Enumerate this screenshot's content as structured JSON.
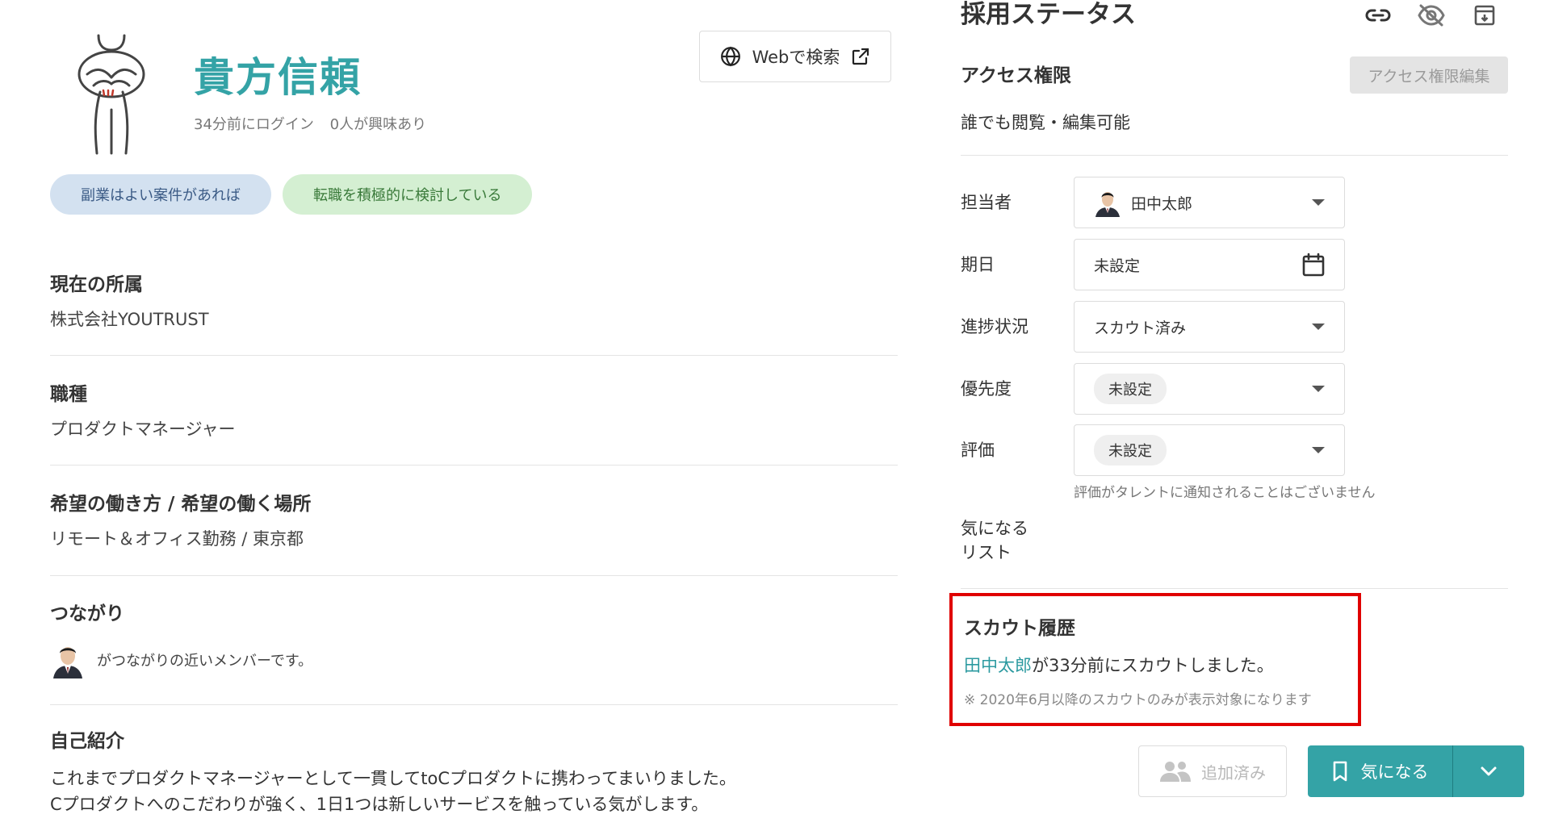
{
  "profile": {
    "name": "貴方信頼",
    "last_login": "34分前にログイン",
    "interest": "0人が興味あり",
    "web_search_label": "Webで検索",
    "tags": [
      "副業はよい案件があれば",
      "転職を積極的に検討している"
    ]
  },
  "sections": {
    "affiliation": {
      "title": "現在の所属",
      "value": "株式会社YOUTRUST"
    },
    "occupation": {
      "title": "職種",
      "value": "プロダクトマネージャー"
    },
    "work_style": {
      "title": "希望の働き方 / 希望の働く場所",
      "value": "リモート＆オフィス勤務 / 東京都"
    },
    "connection": {
      "title": "つながり",
      "text": "がつながりの近いメンバーです。"
    },
    "intro": {
      "title": "自己紹介",
      "lines": [
        "これまでプロダクトマネージャーとして一貫してtoCプロダクトに携わってまいりました。",
        "Cプロダクトへのこだわりが強く、1日1つは新しいサービスを触っている気がします。"
      ]
    }
  },
  "status_panel": {
    "title": "採用ステータス",
    "icons": [
      "link-icon",
      "eye-off-icon",
      "archive-icon"
    ],
    "access": {
      "title": "アクセス権限",
      "edit_label": "アクセス権限編集",
      "value": "誰でも閲覧・編集可能"
    },
    "fields": {
      "assignee": {
        "label": "担当者",
        "value": "田中太郎"
      },
      "due_date": {
        "label": "期日",
        "value": "未設定"
      },
      "progress": {
        "label": "進捗状況",
        "value": "スカウト済み"
      },
      "priority": {
        "label": "優先度",
        "value": "未設定"
      },
      "evaluation": {
        "label": "評価",
        "value": "未設定"
      },
      "watchlist": {
        "label_line1": "気になる",
        "label_line2": "リスト"
      }
    },
    "evaluation_note": "評価がタレントに通知されることはございません"
  },
  "scout_history": {
    "title": "スカウト履歴",
    "user": "田中太郎",
    "message": "が33分前にスカウトしました。",
    "footnote": "※ 2020年6月以降のスカウトのみが表示対象になります"
  },
  "actions": {
    "added_label": "追加済み",
    "interest_label": "気になる"
  },
  "colors": {
    "accent": "#34a3a6",
    "highlight_border": "#e00000"
  }
}
